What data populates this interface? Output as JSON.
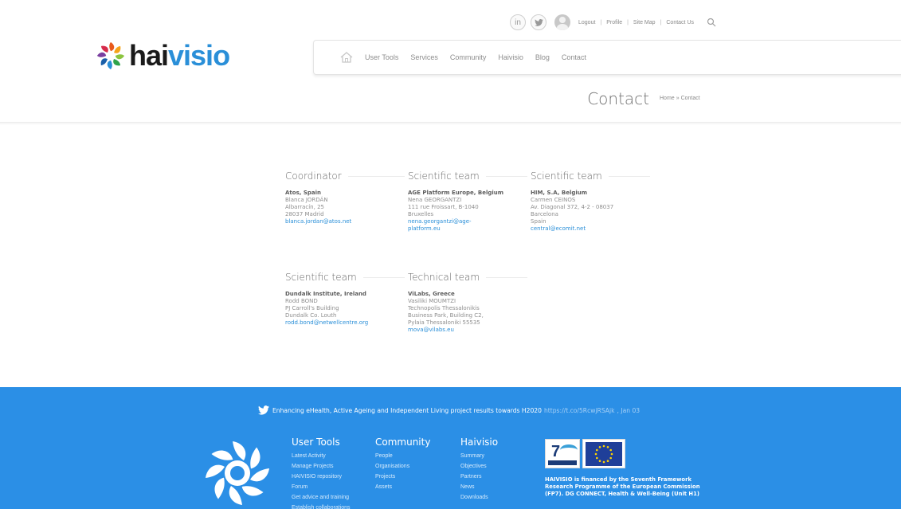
{
  "header": {
    "logo": {
      "hai": "hai",
      "visio": "visio"
    },
    "social": [
      {
        "label": "in",
        "icon": "linkedin-icon"
      },
      {
        "label": "❦",
        "icon": "twitter-icon"
      }
    ],
    "top_links": [
      "Logout",
      "Profile",
      "Site Map",
      "Contact Us"
    ],
    "nav": [
      "User Tools",
      "Services",
      "Community",
      "Haivisio",
      "Blog",
      "Contact"
    ]
  },
  "page": {
    "title": "Contact",
    "breadcrumb": {
      "home": "Home",
      "sep": "»",
      "current": "Contact"
    }
  },
  "contacts": [
    {
      "title": "Coordinator",
      "org": "Atos, Spain",
      "lines": [
        "Blanca JORDÁN",
        "Albarracín, 25",
        "28037 Madrid"
      ],
      "email": [
        "blanca.jordan@atos.net"
      ]
    },
    {
      "title": "Scientific team",
      "org": "AGE Platform Europe, Belgium",
      "lines": [
        "Nena GEORGANTZI",
        "111 rue Froissart, B-1040",
        "Bruxelles"
      ],
      "email": [
        "nena.georgantzi@age-",
        "platform.eu"
      ]
    },
    {
      "title": "Scientific team",
      "org": "HIM, S.A, Belgium",
      "lines": [
        "Carmen CEINOS",
        "Av. Diagonal 372, 4-2 - 08037",
        "Barcelona",
        "Spain"
      ],
      "email": [
        "central@ecomit.net"
      ]
    },
    {
      "title": "Scientific team",
      "org": "Dundalk Institute, Ireland",
      "lines": [
        "Rodd BOND",
        "PJ Carroll's Building",
        "Dundalk Co. Louth"
      ],
      "email": [
        "rodd.bond@netwellcentre.org"
      ]
    },
    {
      "title": "Technical team",
      "org": "ViLabs, Greece",
      "lines": [
        "Vasiliki MOUMTZI",
        "Technopolis Thessalonikis",
        "Business Park, Building C2,",
        "Pylaia Thessaloniki 55535"
      ],
      "email": [
        "mova@vilabs.eu"
      ]
    }
  ],
  "footer": {
    "tweet": {
      "text": "Enhancing eHealth, Active Ageing and Independent Living project results towards H2020",
      "link": "https://t.co/5RcwjRSAjk",
      "date": ", Jan 03"
    },
    "columns": [
      {
        "title": "User Tools",
        "items": [
          "Latest Activity",
          "Manage Projects",
          "HAIVISIO repository",
          "Forum",
          "Get advice and training",
          "Establish collaborations"
        ]
      },
      {
        "title": "Community",
        "items": [
          "People",
          "Organisations",
          "Projects",
          "Assets"
        ]
      },
      {
        "title": "Haivisio",
        "items": [
          "Summary",
          "Objectives",
          "Partners",
          "News",
          "Downloads"
        ]
      }
    ],
    "eu_text": "HAIVISIO is financed by the Seventh Framework Research Programme of the European Commission (FP7). DG CONNECT, Health & Well-Being (Unit H1)"
  },
  "colors": {
    "brand_blue": "#2a8fd8",
    "footer_blue": "#2b8fe6",
    "logo_orange": "#e85a1c"
  }
}
